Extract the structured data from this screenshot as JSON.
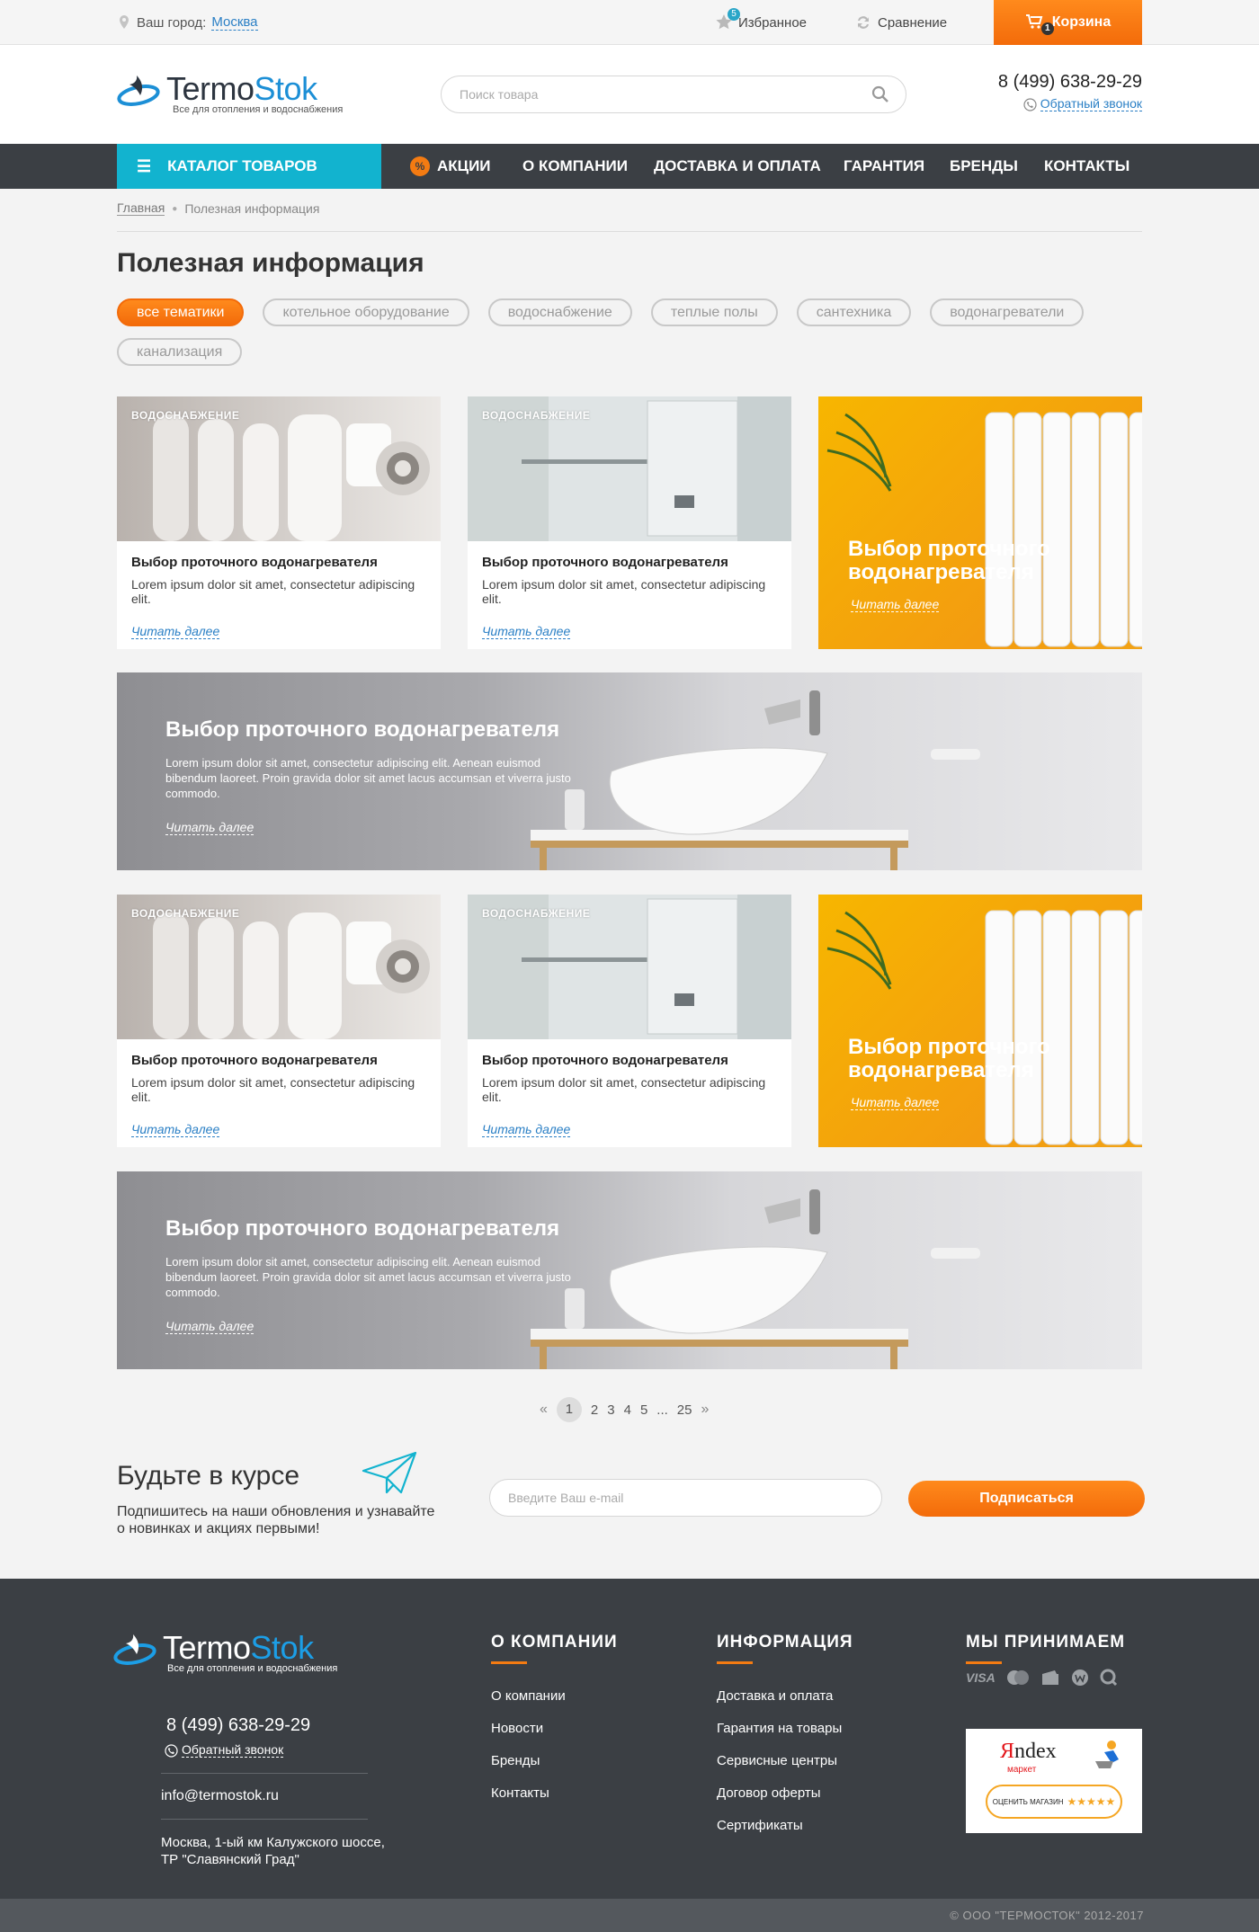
{
  "topbar": {
    "city_label": "Ваш город:",
    "city": "Москва",
    "favorites_label": "Избранное",
    "favorites_count": "5",
    "compare_label": "Сравнение",
    "cart_label": "Корзина",
    "cart_count": "1"
  },
  "header": {
    "logo_part1": "Termo",
    "logo_part2": "Stok",
    "logo_tagline": "Все для отопления и водоснабжения",
    "search_placeholder": "Поиск товара",
    "phone": "8 (499) 638-29-29",
    "callback": "Обратный звонок"
  },
  "nav": {
    "catalog": "КАТАЛОГ ТОВАРОВ",
    "sale_icon": "%",
    "items": [
      "АКЦИИ",
      "О КОМПАНИИ",
      "ДОСТАВКА И ОПЛАТА",
      "ГАРАНТИЯ",
      "БРЕНДЫ",
      "КОНТАКТЫ"
    ]
  },
  "breadcrumb": {
    "home": "Главная",
    "current": "Полезная информация"
  },
  "page_title": "Полезная информация",
  "filters": [
    "все тематики",
    "котельное оборудование",
    "водоснабжение",
    "теплые полы",
    "сантехника",
    "водонагреватели",
    "канализация"
  ],
  "cards": {
    "category": "ВОДОСНАБЖЕНИЕ",
    "title": "Выбор проточного водонагревателя",
    "text": "Lorem ipsum dolor sit amet, consectetur adipiscing elit.",
    "more": "Читать далее"
  },
  "yellow_card": {
    "title": "Выбор проточного водонагревателя",
    "more": "Читать далее"
  },
  "banner": {
    "title": "Выбор проточного водонагревателя",
    "text": "Lorem ipsum dolor sit amet, consectetur adipiscing elit. Aenean euismod bibendum laoreet. Proin gravida dolor sit amet lacus accumsan et viverra justo commodo.",
    "more": "Читать далее"
  },
  "pager": {
    "prev": "«",
    "pages": [
      "1",
      "2",
      "3",
      "4",
      "5"
    ],
    "ellipsis": "...",
    "last": "25",
    "next": "»",
    "current": "1"
  },
  "subscribe": {
    "title": "Будьте в курсе",
    "text": "Подпишитесь на наши обновления и узнавайте о новинках и акциях первыми!",
    "email_placeholder": "Введите Ваш e-mail",
    "button": "Подписаться"
  },
  "footer": {
    "phone": "8 (499) 638-29-29",
    "callback": "Обратный звонок",
    "email": "info@termostok.ru",
    "address": "Москва, 1-ый км Калужского шоссе, ТР \"Славянский Град\"",
    "col_company": {
      "title": "О КОМПАНИИ",
      "links": [
        "О компании",
        "Новости",
        "Бренды",
        "Контакты"
      ]
    },
    "col_info": {
      "title": "ИНФОРМАЦИЯ",
      "links": [
        "Доставка и оплата",
        "Гарантия на товары",
        "Сервисные центры",
        "Договор оферты",
        "Сертификаты"
      ]
    },
    "col_pay": {
      "title": "МЫ ПРИНИМАЕМ",
      "visa": "VISA"
    },
    "yandex": {
      "logo_y": "Я",
      "logo_rest": "ndex",
      "sub": "маркет",
      "rate": "ОЦЕНИТЬ МАГАЗИН",
      "stars": "★★★★★"
    },
    "copyright": "© ООО \"ТЕРМОСТОК\" 2012-2017"
  },
  "colors": {
    "accent_orange": "#f47b12",
    "catalog_cyan": "#12b3cf",
    "nav_dark": "#3b3f44",
    "link_blue": "#2a7fc5"
  }
}
